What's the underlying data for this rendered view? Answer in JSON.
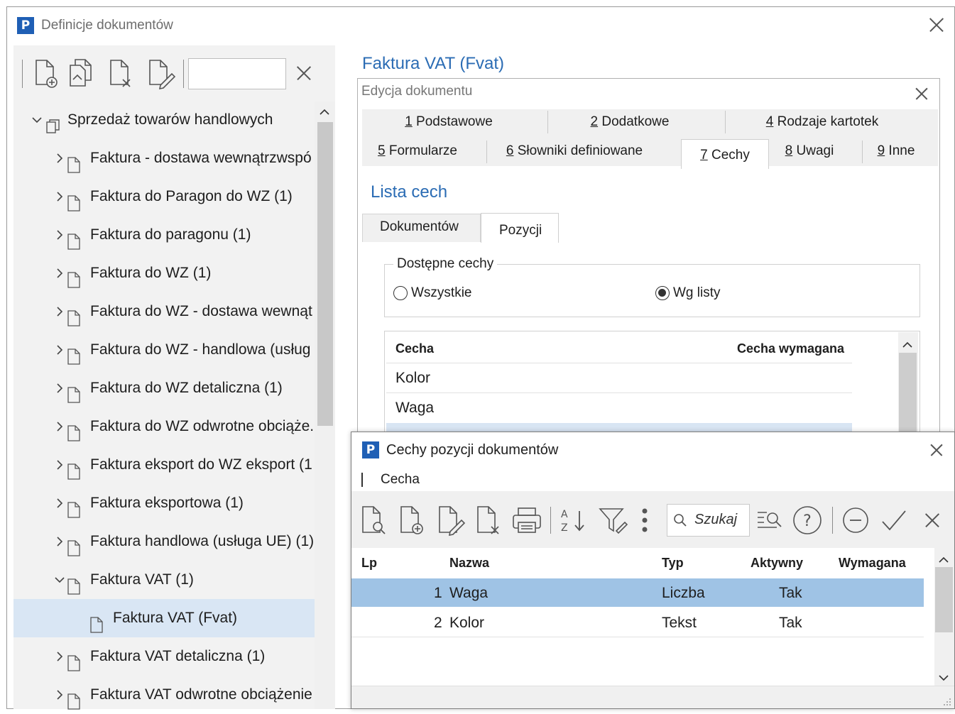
{
  "window": {
    "title": "Definicje dokumentów"
  },
  "left": {
    "toolbar": [
      "add-document-icon",
      "copy-document-icon",
      "delete-document-icon",
      "edit-document-icon"
    ],
    "search_value": "",
    "tree": [
      {
        "label": "Sprzedaż towarów handlowych",
        "level": 0,
        "expanded": true
      },
      {
        "label": "Faktura - dostawa wewnątrzwspó",
        "level": 1,
        "expanded": false
      },
      {
        "label": "Faktura do Paragon do WZ (1)",
        "level": 1,
        "expanded": false
      },
      {
        "label": "Faktura do paragonu (1)",
        "level": 1,
        "expanded": false
      },
      {
        "label": "Faktura do WZ (1)",
        "level": 1,
        "expanded": false
      },
      {
        "label": "Faktura do WZ - dostawa wewnąt",
        "level": 1,
        "expanded": false
      },
      {
        "label": "Faktura do WZ - handlowa (usług",
        "level": 1,
        "expanded": false
      },
      {
        "label": "Faktura do WZ detaliczna (1)",
        "level": 1,
        "expanded": false
      },
      {
        "label": "Faktura do WZ odwrotne obciąże.",
        "level": 1,
        "expanded": false
      },
      {
        "label": "Faktura eksport do WZ eksport (1",
        "level": 1,
        "expanded": false
      },
      {
        "label": "Faktura eksportowa (1)",
        "level": 1,
        "expanded": false
      },
      {
        "label": "Faktura handlowa (usługa UE) (1)",
        "level": 1,
        "expanded": false
      },
      {
        "label": "Faktura VAT (1)",
        "level": 1,
        "expanded": true
      },
      {
        "label": "Faktura VAT (Fvat)",
        "level": 2,
        "selected": true
      },
      {
        "label": "Faktura VAT detaliczna (1)",
        "level": 1,
        "expanded": false
      },
      {
        "label": "Faktura VAT odwrotne obciążenie",
        "level": 1,
        "expanded": false
      }
    ]
  },
  "doc": {
    "heading": "Faktura VAT (Fvat)",
    "edit_title": "Edycja dokumentu",
    "tabs_row1": [
      {
        "key": "1",
        "rest": " Podstawowe"
      },
      {
        "key": "2",
        "rest": " Dodatkowe"
      },
      {
        "key": "4",
        "rest": " Rodzaje kartotek"
      }
    ],
    "tabs_row2": [
      {
        "key": "5",
        "rest": " Formularze"
      },
      {
        "key": "6",
        "rest": " Słowniki definiowane"
      },
      {
        "key": "7",
        "rest": " Cechy",
        "active": true
      },
      {
        "key": "8",
        "rest": " Uwagi"
      },
      {
        "key": "9",
        "rest": " Inne"
      }
    ],
    "list_heading": "Lista cech",
    "subtabs": [
      "Dokumentów",
      "Pozycji"
    ],
    "group_label": "Dostępne cechy",
    "radio_all": "Wszystkie",
    "radio_list": "Wg listy",
    "grid": {
      "col_cecha": "Cecha",
      "col_wymagana": "Cecha wymagana",
      "rows": [
        "Kolor",
        "Waga"
      ]
    }
  },
  "popup": {
    "title": "Cechy pozycji dokumentów",
    "menu_item": "Cecha",
    "search_placeholder": "Szukaj",
    "columns": {
      "lp": "Lp",
      "nazwa": "Nazwa",
      "typ": "Typ",
      "aktywny": "Aktywny",
      "wymagana": "Wymagana"
    },
    "rows": [
      {
        "lp": "1",
        "nazwa": "Waga",
        "typ": "Liczba",
        "aktywny": "Tak",
        "wymagana": "",
        "selected": true
      },
      {
        "lp": "2",
        "nazwa": "Kolor",
        "typ": "Tekst",
        "aktywny": "Tak",
        "wymagana": ""
      }
    ]
  },
  "colors": {
    "accent": "#2b6cb4",
    "logo": "#1f5fb5",
    "selection": "#9fc3e5",
    "tree_selection": "#d9e6f4"
  }
}
